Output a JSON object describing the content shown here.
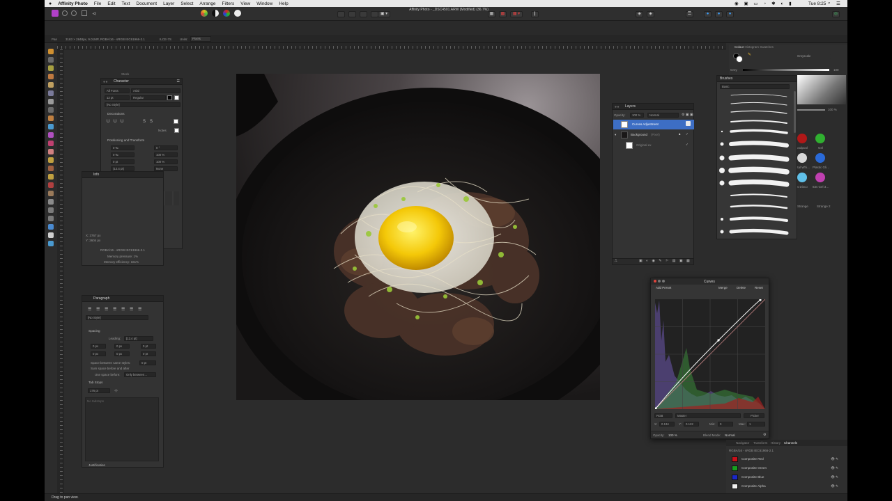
{
  "menubar": {
    "app": "Affinity Photo",
    "items": [
      "File",
      "Edit",
      "Text",
      "Document",
      "Layer",
      "Select",
      "Arrange",
      "Filters",
      "View",
      "Window",
      "Help"
    ],
    "clock": "Tue 8:25"
  },
  "window_title": "Affinity Photo - _DSC4501.ARW (Modified) (36.7%)",
  "context_bar": {
    "tool": "Pan",
    "doc_info": "3183 × 2848px, 9.01MP, RGBA/16 - sRGB IEC61966-2.1",
    "camera": "ILCE-7S",
    "units_label": "Units:",
    "units_value": "Pixels"
  },
  "stock_panel": {
    "title": "Stock"
  },
  "character_panel": {
    "title": "Character",
    "font_collection": "All Fonts",
    "font_family": "Arial",
    "font_size": "12 pt",
    "font_style": "Regular",
    "style": "[No Style]",
    "decorations_label": "Decorations",
    "notes_label": "Notes",
    "positioning_label": "Positioning and Transform",
    "tracking": "0 ‰",
    "kerning": "0 ‰",
    "baseline": "0 pt",
    "leading": "(12.4 pt)",
    "skew": "0 °",
    "scale_h": "100 %",
    "scale_v": "100 %",
    "case": "None",
    "no_break": "No break",
    "typography_label": "Typography",
    "language_label": "Language",
    "optical_label": "Optical Alignment"
  },
  "info_panel": {
    "title": "Info",
    "x": "X: 3767 px",
    "y": "Y: 2604 px",
    "profile": "RGBA/16 - sRGB IEC61966-2.1",
    "memory_pressure": "Memory pressure: 1%",
    "memory_efficiency": "Memory efficiency: 161%"
  },
  "paragraph_panel": {
    "title": "Paragraph",
    "style": "[No Style]",
    "spacing_label": "Spacing",
    "leading": "Leading:",
    "leading_value": "[12.4 pt]",
    "fields": [
      "0 px",
      "0 px",
      "0 pt",
      "0 px",
      "0 px",
      "0 pt"
    ],
    "space_same": "Space between same styles:",
    "space_same_value": "0 pt",
    "sum_space": "Sum space before and after",
    "use_space": "Use space before:",
    "use_space_value": "Only between…",
    "tab_stops_label": "Tab Stops",
    "tab_value": "176 pt",
    "no_tabstops": "No tabstops",
    "justification_label": "Justification"
  },
  "layers_panel": {
    "title": "Layers",
    "opacity_label": "Opacity:",
    "opacity_value": "100 %",
    "blend": "Normal",
    "layers": [
      {
        "name": "Curves Adjustment",
        "selected": true
      },
      {
        "name": "Background",
        "tag": "(Pixel)",
        "selected": false
      },
      {
        "name": "Original ex",
        "selected": false
      }
    ]
  },
  "colour_panel": {
    "tabs": [
      "Colour",
      "Histogram",
      "Swatches"
    ],
    "mode": "Greyscale",
    "grey_label": "Grey",
    "grey_value": "100"
  },
  "brushes_panel": {
    "title": "Brushes",
    "category": "Basic",
    "size_value": "100 %",
    "sample_labels": [
      "Shark",
      "Bloodpool",
      "Gel",
      "Metal Whi…",
      "Plastic Gli…",
      "Gel",
      "83s Disco",
      "83s Gel 3…",
      "Touch",
      "Strange",
      "Strange 2"
    ]
  },
  "curves_dialog": {
    "title": "Curves",
    "add_preset": "Add Preset",
    "merge": "Merge",
    "delete": "Delete",
    "reset": "Reset",
    "space": "RGB",
    "channel": "Master",
    "picker": "Picker",
    "x_label": "X:",
    "x_value": "0.134",
    "y_label": "Y:",
    "y_value": "0.122",
    "min_label": "Min:",
    "min_value": "0",
    "max_label": "Max:",
    "max_value": "1",
    "opacity_label": "Opacity:",
    "opacity_value": "100 %",
    "blend_label": "Blend Mode:",
    "blend_value": "Normal"
  },
  "channels_panel": {
    "tabs": [
      "Navigator",
      "Transform",
      "History",
      "Channels"
    ],
    "active_tab": "Channels",
    "profile": "RGBA/16 - sRGB IEC61966-2.1",
    "channels": [
      {
        "name": "Composite Red",
        "color": "#c8101a"
      },
      {
        "name": "Composite Green",
        "color": "#18a020"
      },
      {
        "name": "Composite Blue",
        "color": "#1a28c8"
      },
      {
        "name": "Composite Alpha",
        "color": "#f2f2f2"
      }
    ]
  },
  "status": "Drag to pan view."
}
